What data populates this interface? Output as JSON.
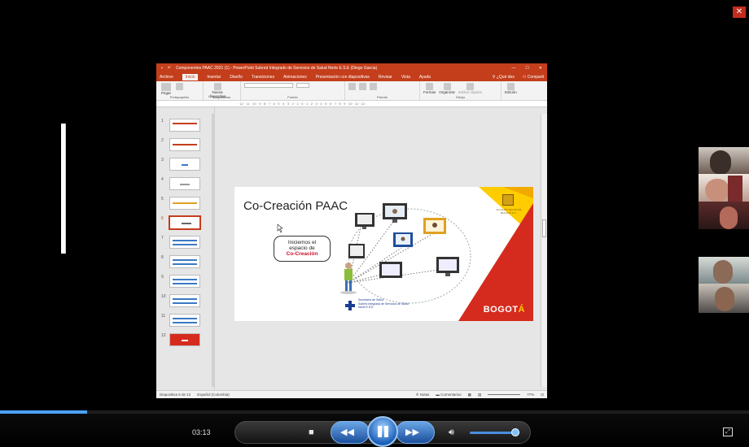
{
  "window_title": "Componentes PAAC 2021 (1) - PowerPoint     Subred Integrado de Servicios de Salud Norte E.S.E (Diego Garcia)",
  "menu": {
    "items": [
      "Archivo",
      "Inicio",
      "Insertar",
      "Diseño",
      "Transiciones",
      "Animaciones",
      "Presentación con diapositivas",
      "Revisar",
      "Vista",
      "Ayuda"
    ],
    "tell_me": "¿Qué des",
    "share": "Comparti"
  },
  "ribbon": {
    "paste": "Pegar",
    "new_slide": "Nueva diapositiva",
    "shapes": "Formas",
    "arrange": "Organizar",
    "quick_styles": "Estilos rápidos",
    "editing": "Edición",
    "groups": [
      "Portapapeles",
      "Diapositivas",
      "Fuente",
      "Párrafo",
      "Dibujo"
    ]
  },
  "ruler_text": "· 12 · 11 · 10 · 9 · 8 · 7 · 6 · 5 · 4 · 3 · 2 · 1 · 0 · 1 · 2 · 3 · 4 · 5 · 6 · 7 · 8 · 9 · 10 · 11 · 12 ·",
  "thumbnails": [
    "1",
    "2",
    "3",
    "4",
    "5",
    "6",
    "7",
    "8",
    "9",
    "10",
    "11",
    "12"
  ],
  "selected_slide": "6",
  "slide": {
    "title": "Co-Creación PAAC",
    "bubble_line1": "Iniciemos el",
    "bubble_line2": "espacio de",
    "bubble_highlight": "Co-Creación",
    "seal_text": "ALCALDÍA MAYOR DE BOGOTÁ D.C.",
    "brand_main": "BOGOT",
    "brand_accent": "Á",
    "org_line1": "Secretaría de Salud",
    "org_line2": "Subred Integrada de Servicios de Salud",
    "org_line3": "Norte E.S.E."
  },
  "status": {
    "slide_counter": "Diapositiva 6 de 12",
    "language": "Español (Colombia)",
    "notes": "Notas",
    "comments": "Comentarios",
    "zoom": "77%"
  },
  "player": {
    "time": "03:13",
    "progress": 0.116,
    "volume": 0.85
  },
  "colors": {
    "ppt_red": "#c43e1c",
    "bogota_red": "#d52b1e",
    "bogota_yellow": "#ffcc00",
    "player_blue": "#4ba3ff"
  }
}
